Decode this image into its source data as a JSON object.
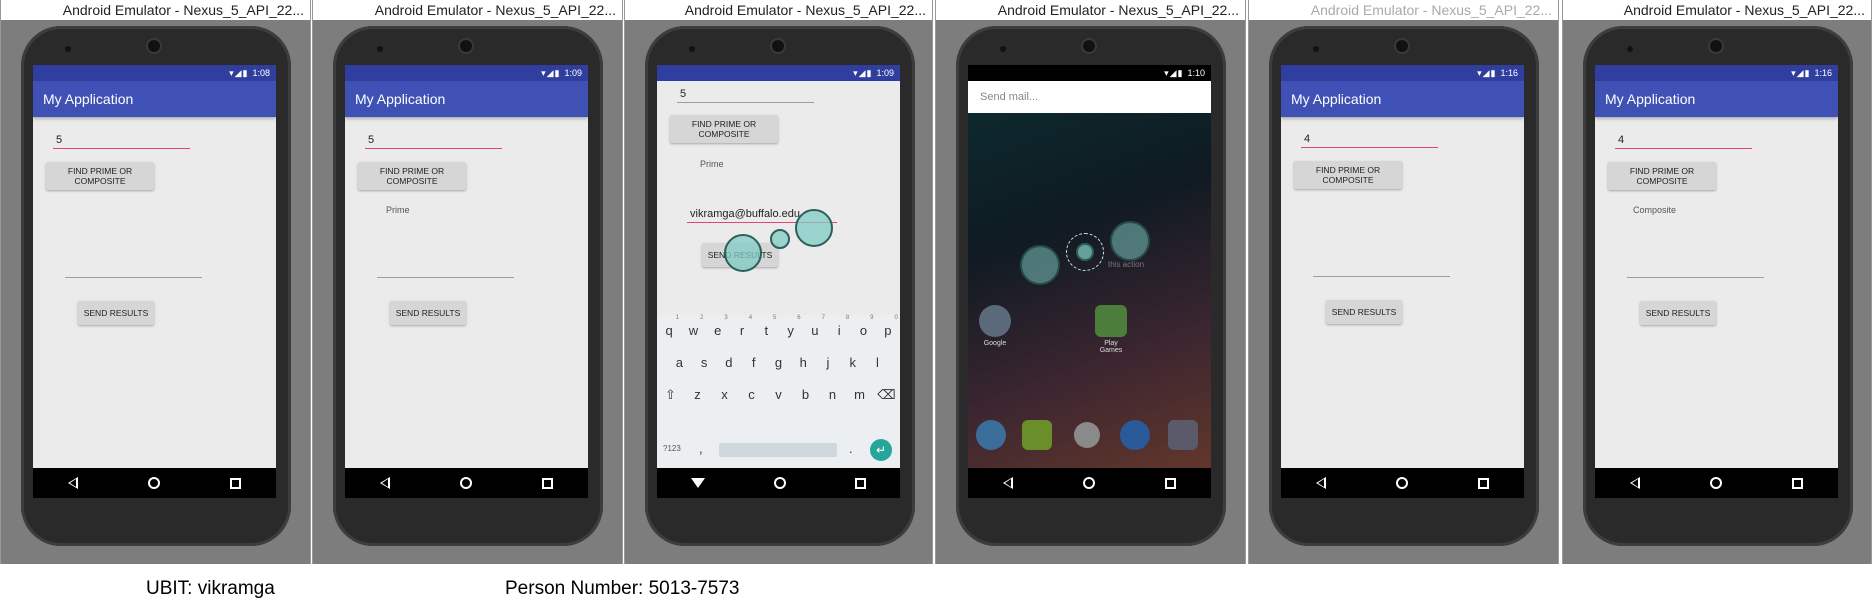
{
  "window_title": "Android Emulator - Nexus_5_API_22...",
  "app_title": "My Application",
  "find_button": "FIND PRIME OR COMPOSITE",
  "send_button": "SEND RESULTS",
  "screens": [
    {
      "time": "1:08",
      "number": "5",
      "result": ""
    },
    {
      "time": "1:09",
      "number": "5",
      "result": "Prime"
    },
    {
      "time": "1:09",
      "number": "5",
      "result": "Prime",
      "email": "vikramga@buffalo.edu"
    },
    {
      "time": "1:10",
      "search_placeholder": "Send mail...",
      "apps": [
        "Google",
        "Play Games"
      ],
      "hint_text": "this action"
    },
    {
      "time": "1:16",
      "number": "4",
      "result": ""
    },
    {
      "time": "1:16",
      "number": "4",
      "result": "Composite"
    }
  ],
  "keyboard": {
    "row1": [
      "q",
      "w",
      "e",
      "r",
      "t",
      "y",
      "u",
      "i",
      "o",
      "p"
    ],
    "row1_hints": [
      "1",
      "2",
      "3",
      "4",
      "5",
      "6",
      "7",
      "8",
      "9",
      "0"
    ],
    "row2": [
      "a",
      "s",
      "d",
      "f",
      "g",
      "h",
      "j",
      "k",
      "l"
    ],
    "row3": [
      "z",
      "x",
      "c",
      "v",
      "b",
      "n",
      "m"
    ],
    "symbols": "?123",
    "comma": ",",
    "period": "."
  },
  "captions": {
    "ubit": "UBIT: vikramga",
    "person_number": "Person Number: 5013-7573"
  },
  "colors": {
    "primary": "#3f51b5",
    "primary_dark": "#303f9f",
    "accent_underline": "#e2476d",
    "touch_indicator": "#80cbc4"
  }
}
